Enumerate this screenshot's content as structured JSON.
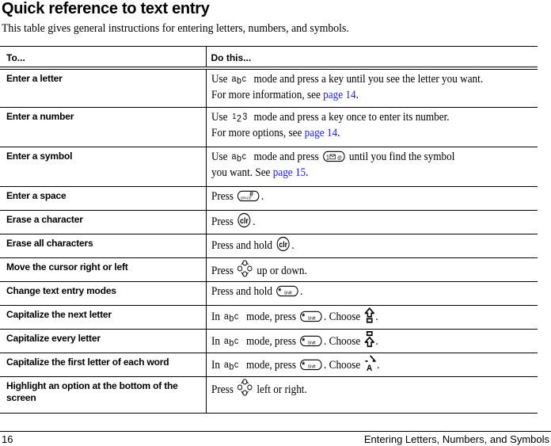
{
  "page": {
    "title": "Quick reference to text entry",
    "intro": "This table gives general instructions for entering letters, numbers, and symbols."
  },
  "table": {
    "headers": {
      "to": "To...",
      "do": "Do this..."
    },
    "rows": [
      {
        "to": "Enter a letter",
        "do": {
          "pre": "Use",
          "mode": "abc",
          "post": "mode and press a key until you see the letter you want.",
          "line2": "For more information, see",
          "link": "page 14",
          "end": "."
        }
      },
      {
        "to": "Enter a number",
        "do": {
          "pre": "Use",
          "mode": "123",
          "post": "mode and press a key once to enter its number.",
          "line2": "For more options, see",
          "link": "page 14",
          "end": "."
        }
      },
      {
        "to": "Enter a symbol",
        "do": {
          "pre": "Use",
          "mode": "abc",
          "mid": "mode and press",
          "key": "symbol-key",
          "post": "until you find the symbol",
          "line2": "you want. See",
          "link": "page 15",
          "end": "."
        }
      },
      {
        "to": "Enter a space",
        "do": {
          "pre": "Press",
          "key": "space-key",
          "end": "."
        }
      },
      {
        "to": "Erase a character",
        "do": {
          "pre": "Press",
          "key": "clr-key",
          "end": "."
        }
      },
      {
        "to": "Erase all characters",
        "do": {
          "pre": "Press and hold",
          "key": "clr-key",
          "end": "."
        }
      },
      {
        "to": "Move the cursor right or left",
        "do": {
          "pre": "Press",
          "key": "nav-key",
          "post": "up or down."
        }
      },
      {
        "to": "Change text entry modes",
        "do": {
          "pre": "Press and hold",
          "key": "shift-key",
          "end": "."
        }
      },
      {
        "to": "Capitalize the next letter",
        "do": {
          "pre": "In",
          "mode": "abc",
          "mid": "mode, press",
          "key": "shift-key",
          "choose": ". Choose",
          "icon": "shift-once-icon",
          "end": "."
        }
      },
      {
        "to": "Capitalize every letter",
        "do": {
          "pre": "In",
          "mode": "abc",
          "mid": "mode, press",
          "key": "shift-key",
          "choose": ". Choose",
          "icon": "caps-lock-icon",
          "end": "."
        }
      },
      {
        "to": "Capitalize the first letter of each word",
        "do": {
          "pre": "In",
          "mode": "abc",
          "mid": "mode, press",
          "key": "shift-key",
          "choose": ". Choose",
          "icon": "word-caps-icon",
          "end": "."
        }
      },
      {
        "to": "Highlight an option at the bottom of the screen",
        "do": {
          "pre": "Press",
          "key": "nav-key",
          "post": "left or right."
        }
      }
    ]
  },
  "footer": {
    "page_number": "16",
    "section_title": "Entering Letters, Numbers, and Symbols"
  }
}
